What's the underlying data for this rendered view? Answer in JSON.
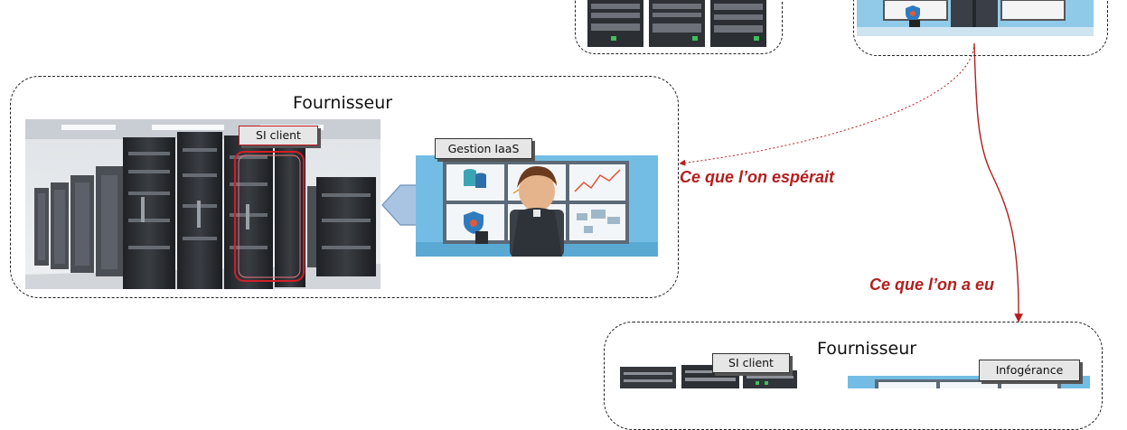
{
  "groups": {
    "provider_left": {
      "title": "Fournisseur"
    },
    "provider_bottom": {
      "title": "Fournisseur"
    }
  },
  "tags": {
    "si_client_main": "SI client",
    "gestion_iaas": "Gestion IaaS",
    "si_client_bottom": "SI client",
    "infogerance": "Infogérance"
  },
  "arrows": {
    "hoped": "Ce que l’on espérait",
    "got": "Ce que l’on a eu"
  },
  "colors": {
    "arrow_red": "#b41e1e",
    "panel_blue": "#6bb7e0",
    "rack_dark": "#2b2e33"
  }
}
